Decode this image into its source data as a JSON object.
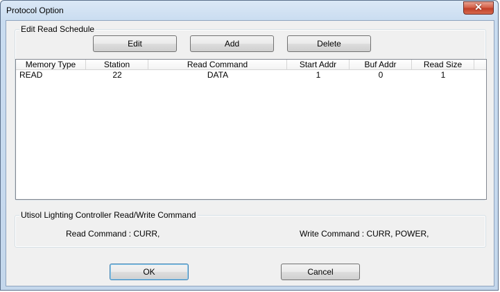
{
  "window": {
    "title": "Protocol Option",
    "close_glyph": "✕"
  },
  "schedule": {
    "group_label": "Edit Read Schedule",
    "buttons": {
      "edit": "Edit",
      "add": "Add",
      "delete": "Delete"
    },
    "columns": [
      "Memory Type",
      "Station",
      "Read Command",
      "Start Addr",
      "Buf Addr",
      "Read Size"
    ],
    "rows": [
      {
        "memory_type": "READ",
        "station": "22",
        "read_command": "DATA",
        "start_addr": "1",
        "buf_addr": "0",
        "read_size": "1"
      }
    ]
  },
  "command": {
    "group_label": "Utisol Lighting Controller Read/Write Command",
    "read_label": "Read Command : CURR,",
    "write_label": "Write Command : CURR, POWER,"
  },
  "footer": {
    "ok": "OK",
    "cancel": "Cancel"
  }
}
